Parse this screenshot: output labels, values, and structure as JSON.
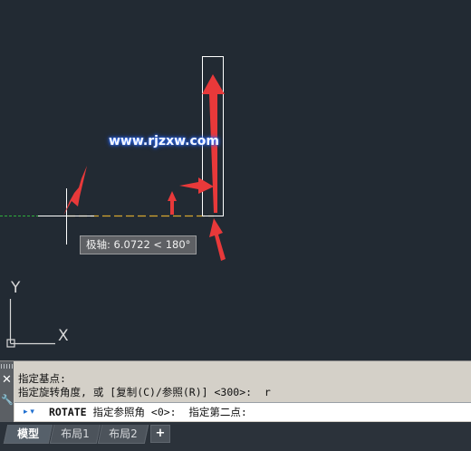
{
  "watermark": "www.rjzxw.com",
  "tooltip": {
    "label": "极轴:",
    "value": "6.0722 < 180°"
  },
  "ucs": {
    "y_label": "Y",
    "x_label": "X"
  },
  "command": {
    "history_line1": "指定基点:",
    "history_line2": "指定旋转角度, 或 [复制(C)/参照(R)] <300>:  r",
    "command_name": "ROTATE",
    "prompt": " 指定参照角 <0>:  指定第二点:"
  },
  "tabs": [
    {
      "label": "模型",
      "active": true
    },
    {
      "label": "布局1",
      "active": false
    },
    {
      "label": "布局2",
      "active": false
    }
  ],
  "add_tab": "+",
  "colors": {
    "canvas": "#222a33",
    "arrow": "#e8393a",
    "polar_track": "#2fae3c",
    "rubberband": "#d6a630",
    "rectangle": "#ffffff"
  }
}
